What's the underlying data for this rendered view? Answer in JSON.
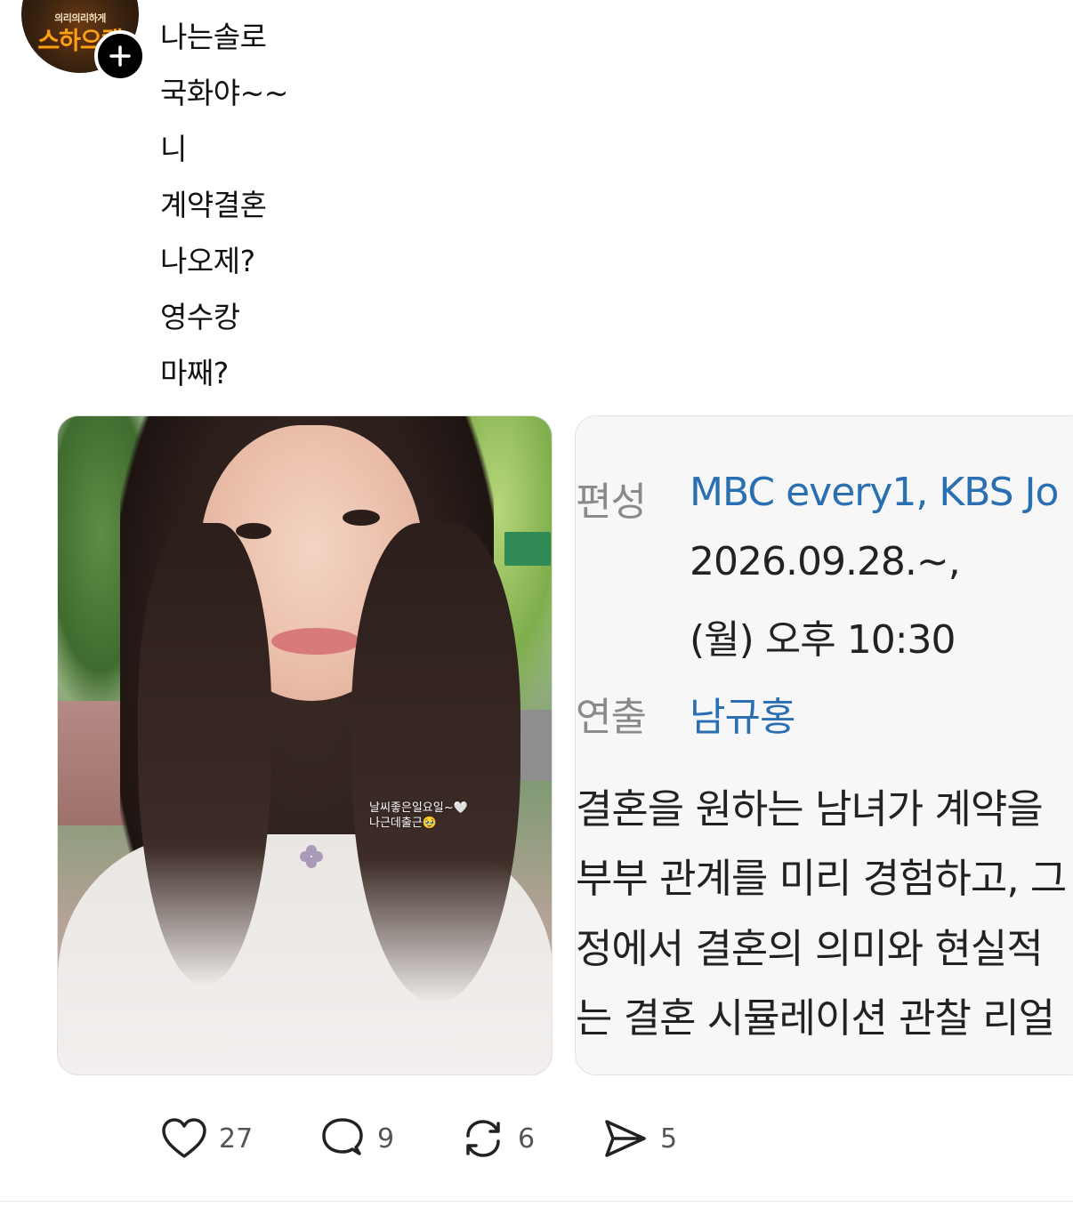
{
  "profile": {
    "avatar_text_top": "의리의리하게",
    "avatar_text_main": "스하으캠"
  },
  "post": {
    "lines": [
      "나는솔로",
      "국화야~~",
      "니",
      "계약결혼",
      "나오제?",
      "영수캉",
      "마째?"
    ]
  },
  "media": [
    {
      "caption_line1": "날씨좋은일요일~🤍",
      "caption_line2": "나근데출근🥹"
    },
    {
      "broadcast_label": "편성",
      "broadcast_value": "MBC every1, KBS Jo",
      "date_line": "2026.09.28.~,",
      "time_line": "(월) 오후 10:30",
      "director_label": "연출",
      "director_value": "남규홍",
      "desc_lines": [
        "결혼을 원하는 남녀가 계약을",
        "부부 관계를 미리 경험하고, 그",
        "정에서 결혼의 의미와 현실적",
        "는 결혼 시뮬레이션 관찰 리얼"
      ]
    }
  ],
  "actions": {
    "likes": "27",
    "replies": "9",
    "reposts": "6",
    "shares": "5"
  },
  "colors": {
    "link": "#2a6fb2",
    "label_gray": "#8a8a8a",
    "brand_orange": "#f4a318"
  }
}
